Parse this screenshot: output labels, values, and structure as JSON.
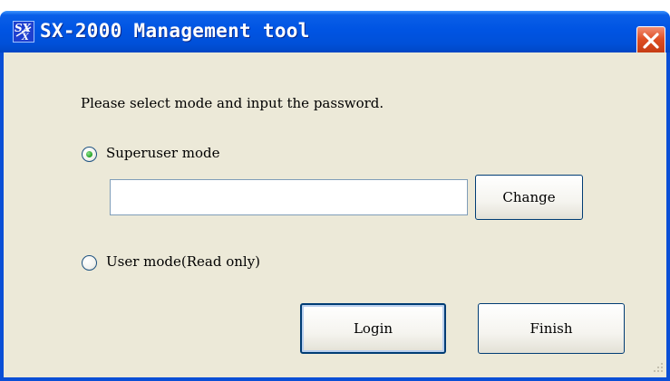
{
  "window": {
    "title": "SX-2000 Management tool",
    "icon": "sx-app-icon",
    "icon_text": "SX",
    "close_icon": "close-icon"
  },
  "dialog": {
    "prompt": "Please select mode and input the password.",
    "modes": [
      {
        "label": "Superuser mode",
        "selected": true
      },
      {
        "label": "User mode(Read only)",
        "selected": false
      }
    ],
    "password": {
      "value": "",
      "placeholder": ""
    },
    "change_label": "Change",
    "login_label": "Login",
    "finish_label": "Finish"
  },
  "colors": {
    "titlebar": "#0054e3",
    "client_bg": "#ece9d8",
    "close_button": "#de4e23",
    "radio_selected": "#21a121"
  }
}
